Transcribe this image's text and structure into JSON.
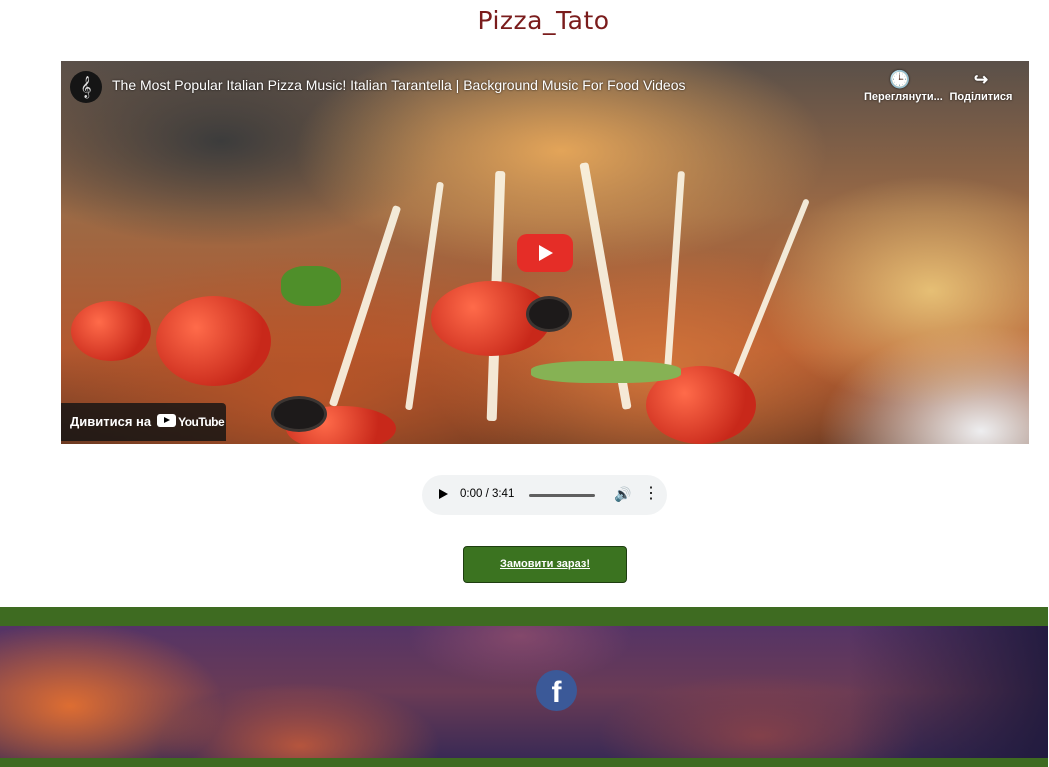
{
  "site": {
    "title": "Pizza_Tato"
  },
  "video": {
    "channel_icon": "treble-clef-icon",
    "channel_glyph": "𝄞",
    "title": "The Most Popular Italian Pizza Music! Italian Tarantella | Background Music For Food Videos",
    "watch_later_label": "Переглянути...",
    "share_label": "Поділитися",
    "watch_later_glyph": "🕒",
    "share_glyph": "↪",
    "watch_on_label": "Дивитися на",
    "youtube_word": "YouTube"
  },
  "audio": {
    "time": "0:00 / 3:41",
    "volume_glyph": "🔊",
    "more_glyph": "⋮"
  },
  "actions": {
    "order_label": "Замовити зараз!"
  },
  "footer": {
    "facebook_glyph": "f"
  },
  "colors": {
    "title": "#7a1c1c",
    "order_button": "#3b7320",
    "footer_band": "#3e6b21",
    "facebook": "#3b5998",
    "play_button": "#e52d27"
  }
}
